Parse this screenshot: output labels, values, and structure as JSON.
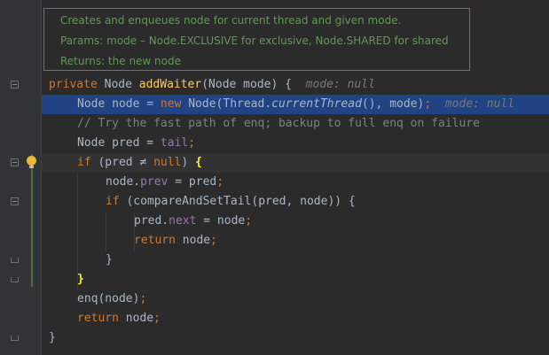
{
  "doc": {
    "line1": "Creates and enqueues node for current thread and given mode.",
    "line2": "Params: mode – Node.EXCLUSIVE for exclusive, Node.SHARED for shared",
    "line3": "Returns: the new node"
  },
  "code": {
    "l1": {
      "kw": "private",
      "type": " Node ",
      "method": "addWaiter",
      "rest": "(Node mode) {",
      "hint": "mode: null"
    },
    "l2": {
      "a": "Node node = ",
      "kw": "new",
      "b": " Node(Thread.",
      "static": "currentThread",
      "c": "(), mode)",
      "semi": ";",
      "hint": "mode: null"
    },
    "l3": {
      "comment": "// Try the fast path of enq; backup to full enq on failure"
    },
    "l4": {
      "a": "Node pred = ",
      "field": "tail",
      "semi": ";"
    },
    "l5": {
      "kw": "if",
      "a": " (pred ≠ ",
      "kw2": "null",
      "b": ") ",
      "brace": "{"
    },
    "l6": {
      "a": "node.",
      "field": "prev",
      "b": " = pred",
      "semi": ";"
    },
    "l7": {
      "kw": "if",
      "a": " (compareAndSetTail(pred, node)) {"
    },
    "l8": {
      "a": "pred.",
      "field": "next",
      "b": " = node",
      "semi": ";"
    },
    "l9": {
      "kw": "return",
      "a": " node",
      "semi": ";"
    },
    "l10": {
      "a": "}"
    },
    "l11": {
      "brace": "}"
    },
    "l12": {
      "a": "enq(node)",
      "semi": ";"
    },
    "l13": {
      "kw": "return",
      "a": " node",
      "semi": ";"
    },
    "l14": {
      "a": "}"
    }
  },
  "colors": {
    "background": "#2b2b2b",
    "selection": "#214283",
    "keyword": "#cc7832",
    "method": "#ffc66d",
    "field": "#9876aa",
    "doc_text": "#629755",
    "doc_border": "#d64545"
  }
}
